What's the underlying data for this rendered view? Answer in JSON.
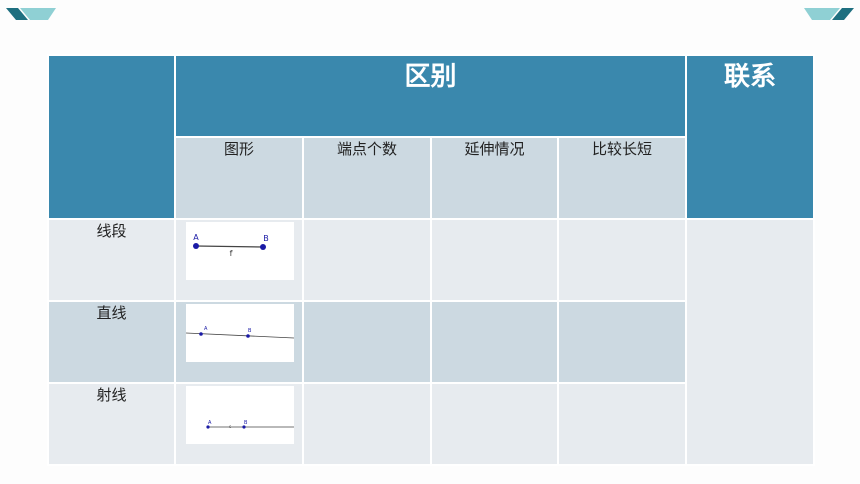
{
  "header": {
    "group_label": "区别",
    "relation_label": "联系"
  },
  "columns": [
    "图形",
    "端点个数",
    "延伸情况",
    "比较长短"
  ],
  "rows": [
    {
      "label": "线段",
      "figure": {
        "type": "segment",
        "points": [
          "A",
          "B"
        ],
        "segment_label": "f"
      }
    },
    {
      "label": "直线",
      "figure": {
        "type": "line",
        "points": [
          "A",
          "B"
        ]
      }
    },
    {
      "label": "射线",
      "figure": {
        "type": "ray",
        "points": [
          "A",
          "B"
        ],
        "extra_label": "c"
      }
    }
  ],
  "colors": {
    "header_dark": "#3a88ad",
    "header_light": "#ccd9e1",
    "row_light": "#e7ebef",
    "row_mid": "#ccd9e1",
    "point": "#1a1aa6"
  }
}
